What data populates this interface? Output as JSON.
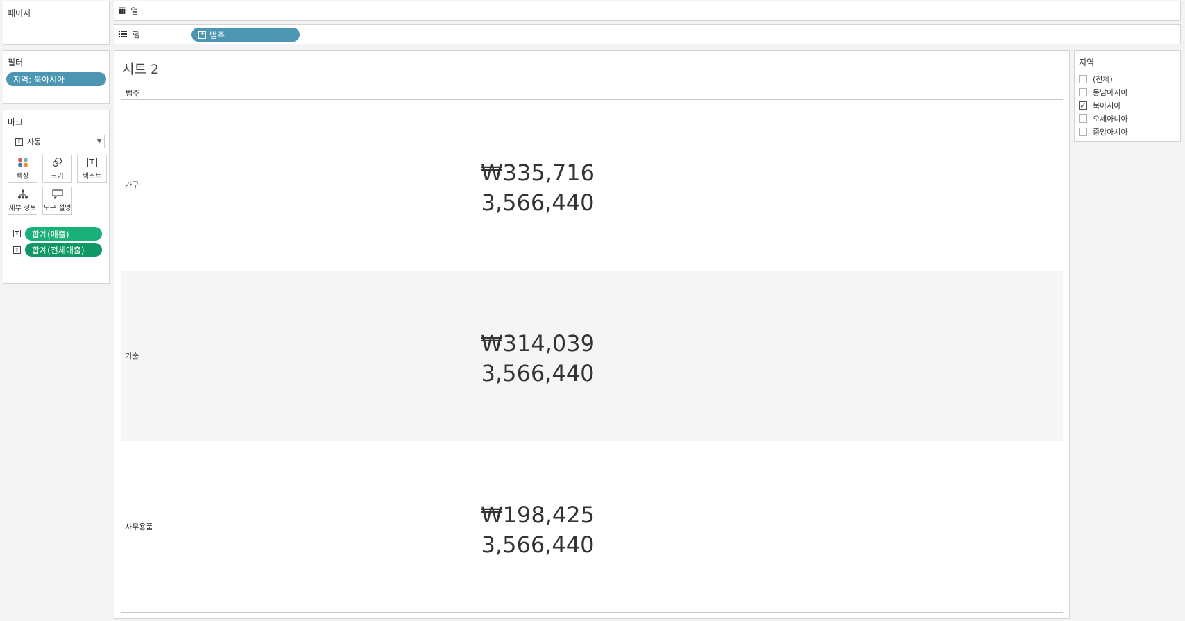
{
  "pages_panel": {
    "title": "페이지"
  },
  "columns_shelf": {
    "label": "열",
    "icon": "columns-icon"
  },
  "rows_shelf": {
    "label": "행",
    "icon": "rows-icon",
    "pill": "범주"
  },
  "filters_panel": {
    "title": "필터",
    "pill": "지역: 북아시아"
  },
  "marks_panel": {
    "title": "마크",
    "mark_type": "자동",
    "buttons": {
      "color": "색상",
      "size": "크기",
      "text": "텍스트",
      "detail": "세부 정보",
      "tooltip": "도구 설명"
    },
    "fields": [
      "합계(매출)",
      "합계(전체매출)"
    ]
  },
  "sheet": {
    "title": "시트 2",
    "row_header": "범주",
    "rows": [
      {
        "label": "가구",
        "sales": "₩335,716",
        "total": "3,566,440"
      },
      {
        "label": "기술",
        "sales": "₩314,039",
        "total": "3,566,440"
      },
      {
        "label": "사무용품",
        "sales": "₩198,425",
        "total": "3,566,440"
      }
    ]
  },
  "legend": {
    "title": "지역",
    "items": [
      {
        "label": "(전체)",
        "checked": false
      },
      {
        "label": "동남아시아",
        "checked": false
      },
      {
        "label": "북아시아",
        "checked": true
      },
      {
        "label": "오세아니아",
        "checked": false
      },
      {
        "label": "중앙아시아",
        "checked": false
      }
    ]
  },
  "colors": {
    "pill_blue": "#4b97b3",
    "pill_green": "#19b079",
    "pill_green_dark": "#0f9765",
    "band": "#f5f5f5"
  }
}
